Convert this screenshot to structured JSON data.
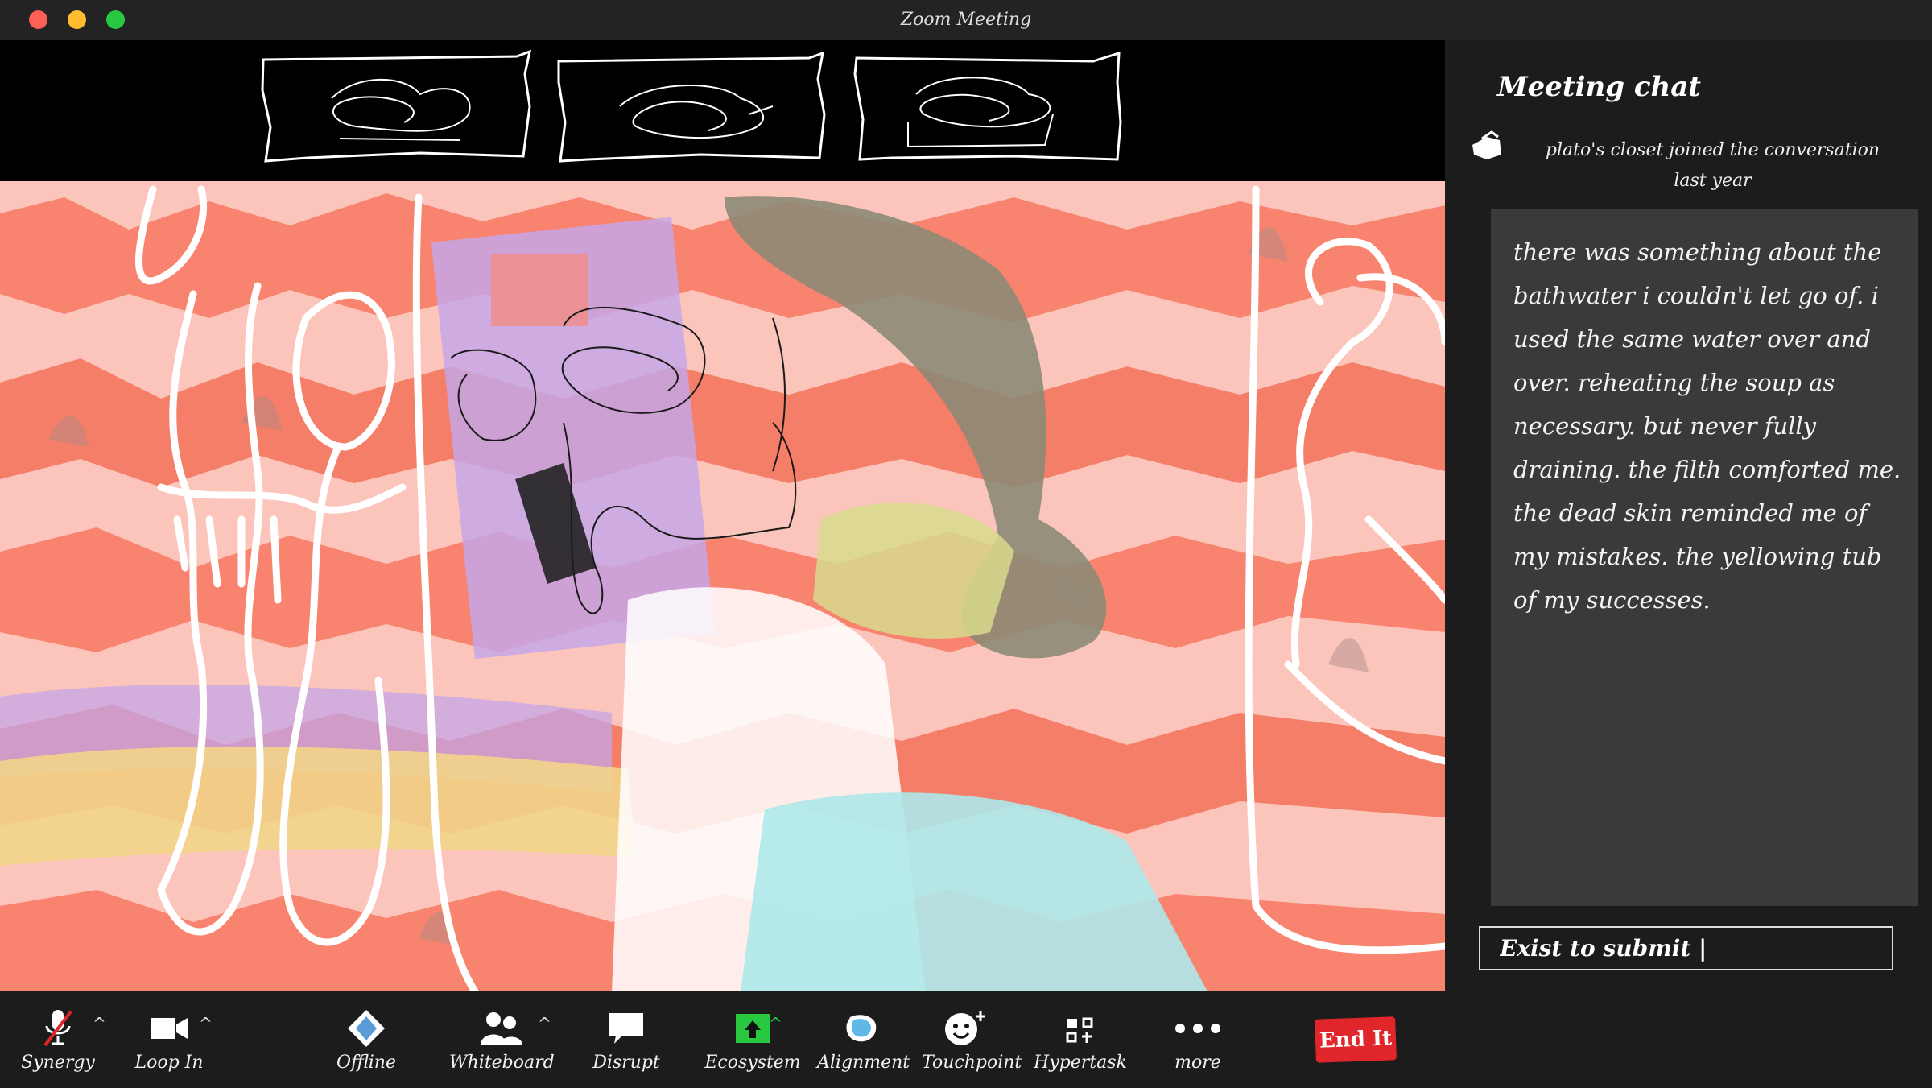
{
  "window": {
    "title": "Zoom Meeting"
  },
  "toolbar": {
    "items": [
      {
        "label": "Synergy",
        "icon": "microphone-muted-icon"
      },
      {
        "label": "Loop In",
        "icon": "video-camera-icon"
      },
      {
        "label": "Offline",
        "icon": "diamond-arrows-icon"
      },
      {
        "label": "Whiteboard",
        "icon": "participants-icon"
      },
      {
        "label": "Disrupt",
        "icon": "speech-bubble-icon"
      },
      {
        "label": "Ecosystem",
        "icon": "share-screen-icon"
      },
      {
        "label": "Alignment",
        "icon": "record-blob-icon"
      },
      {
        "label": "Touchpoint",
        "icon": "reaction-smiley-icon"
      },
      {
        "label": "Hypertask",
        "icon": "apps-icon"
      },
      {
        "label": "more",
        "icon": "more-dots-icon"
      }
    ],
    "end_label": "End It"
  },
  "chat": {
    "title": "Meeting chat",
    "join_line1": "plato's closet  joined the conversation",
    "join_line2": "last year",
    "message": "there was something about the bathwater i couldn't let go of. i used the same water over and over. reheating the soup as necessary. but never fully draining. the filth comforted me. the dead skin reminded me of my mistakes. the yellowing tub of my successes.",
    "input_placeholder": "Exist to submit |"
  },
  "colors": {
    "end_button": "#e0262a",
    "share_icon": "#28c840",
    "wave_coral": "#f88470",
    "wave_pink": "#fbc5bc",
    "lavender": "#c5a6e8",
    "olive": "#8c8a74",
    "cyan": "#aee8ea"
  }
}
